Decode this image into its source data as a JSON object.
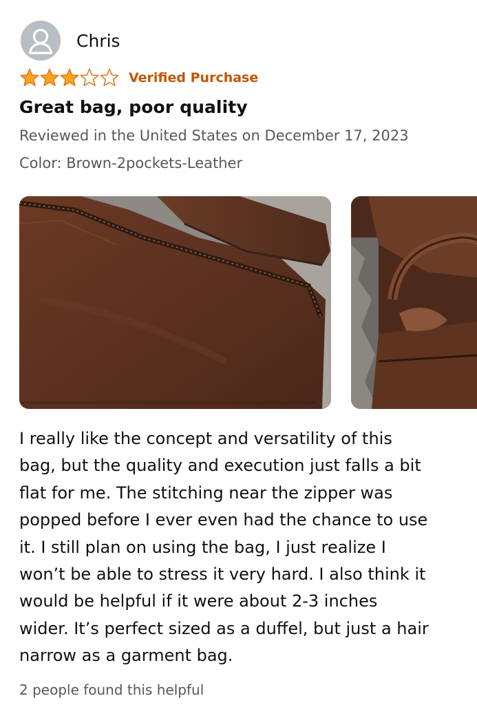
{
  "review": {
    "reviewer_name": "Chris",
    "avatar_icon": "user-silhouette-icon",
    "rating": 3,
    "rating_max": 5,
    "verified_label": "Verified Purchase",
    "title": "Great bag, poor quality",
    "reviewed_line": "Reviewed in the United States on December 17, 2023",
    "color_line": "Color: Brown-2pockets-Leather",
    "body": "I really like the concept and versatility of this\nbag, but the quality and execution just falls a bit\nflat for me. The stitching near the zipper was\npopped before I ever even had the chance to use\nit. I still plan on using the bag, I just realize I\nwon’t be able to stress it very hard. I also think it\nwould be helpful if it were about 2-3 inches\nwider. It’s perfect sized as a duffel, but just a hair\nnarrow as a garment bag.",
    "helpful_text": "2 people found this helpful",
    "photos": [
      {
        "label": "review-photo-zipper-stitching"
      },
      {
        "label": "review-photo-bag-handles"
      }
    ]
  },
  "colors": {
    "star_fill": "#ffa41c",
    "star_outline": "#de7921",
    "verified": "#c45500",
    "secondary_text": "#565959",
    "avatar_bg": "#b8bfc4",
    "leather": "#5a3220"
  }
}
